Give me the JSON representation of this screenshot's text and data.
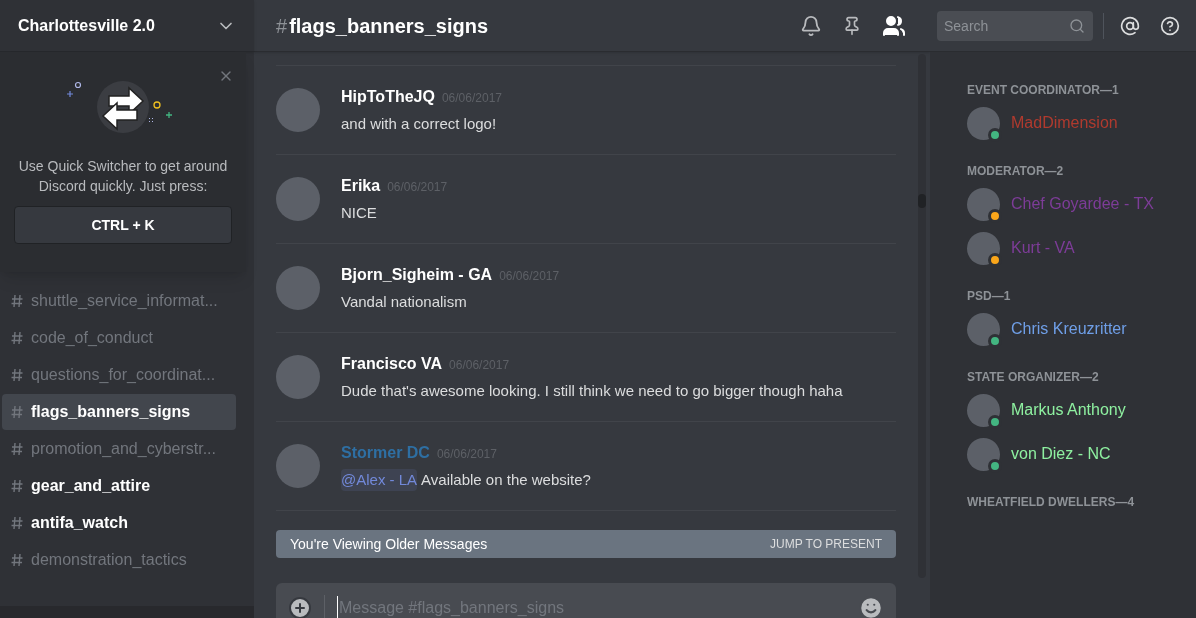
{
  "server": {
    "name": "Charlottesville 2.0"
  },
  "quick_switcher": {
    "text": "Use Quick Switcher to get around Discord quickly. Just press:",
    "shortcut": "CTRL + K"
  },
  "channels": [
    {
      "name": "shuttle_service_informat...",
      "selected": false,
      "unread": false
    },
    {
      "name": "code_of_conduct",
      "selected": false,
      "unread": false
    },
    {
      "name": "questions_for_coordinat...",
      "selected": false,
      "unread": false
    },
    {
      "name": "flags_banners_signs",
      "selected": true,
      "unread": true
    },
    {
      "name": "promotion_and_cyberstr...",
      "selected": false,
      "unread": false
    },
    {
      "name": "gear_and_attire",
      "selected": false,
      "unread": true
    },
    {
      "name": "antifa_watch",
      "selected": false,
      "unread": true
    },
    {
      "name": "demonstration_tactics",
      "selected": false,
      "unread": false
    }
  ],
  "channel_header": {
    "hash": "#",
    "name": "flags_banners_signs",
    "search_placeholder": "Search"
  },
  "messages": [
    {
      "author": "HipToTheJQ",
      "color": "#ffffff",
      "time": "06/06/2017",
      "text": "and with a correct logo!"
    },
    {
      "author": "Erika",
      "color": "#ffffff",
      "time": "06/06/2017",
      "text": "NICE"
    },
    {
      "author": "Bjorn_Sigheim - GA",
      "color": "#ffffff",
      "time": "06/06/2017",
      "text": "Vandal nationalism"
    },
    {
      "author": "Francisco VA",
      "color": "#ffffff",
      "time": "06/06/2017",
      "text": "Dude that's awesome looking. I still think we need to go bigger though haha"
    },
    {
      "author": "Stormer DC",
      "color": "#2e6fa3",
      "time": "06/06/2017",
      "mention": "@Alex - LA",
      "text": "Available on the website?"
    }
  ],
  "older_bar": {
    "text": "You're Viewing Older Messages",
    "action": "JUMP TO PRESENT"
  },
  "composer": {
    "placeholder": "Message #flags_banners_signs"
  },
  "member_groups": [
    {
      "title": "EVENT COORDINATOR—1",
      "members": [
        {
          "name": "MadDimension",
          "color": "#b03a2e",
          "idle": false
        }
      ]
    },
    {
      "title": "MODERATOR—2",
      "members": [
        {
          "name": "Chef Goyardee - TX",
          "color": "#7d3c98",
          "idle": true
        },
        {
          "name": "Kurt - VA",
          "color": "#7d3c98",
          "idle": true
        }
      ]
    },
    {
      "title": "PSD—1",
      "members": [
        {
          "name": "Chris Kreuzritter",
          "color": "#6f9fe8",
          "idle": false
        }
      ]
    },
    {
      "title": "STATE ORGANIZER—2",
      "members": [
        {
          "name": "Markus Anthony",
          "color": "#8ef0a0",
          "idle": false
        },
        {
          "name": "von Diez - NC",
          "color": "#8ef0a0",
          "idle": false
        }
      ]
    },
    {
      "title": "WHEATFIELD DWELLERS—4"
    }
  ]
}
